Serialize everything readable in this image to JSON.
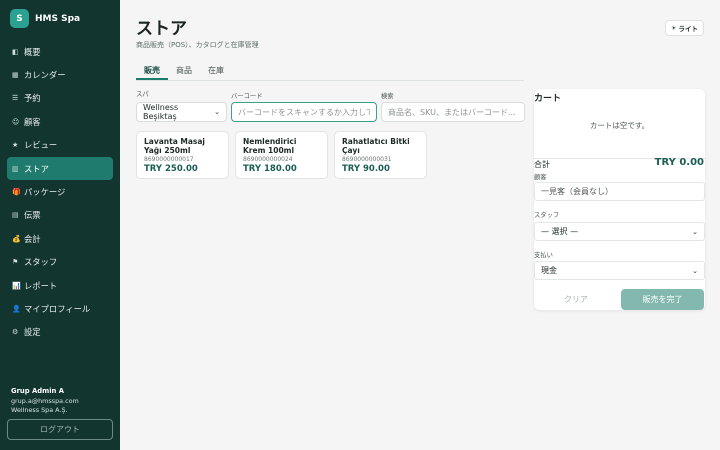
{
  "app": {
    "logo_letter": "S",
    "name": "HMS Spa"
  },
  "sidebar": {
    "items": [
      {
        "icon": "◧",
        "label": "概要"
      },
      {
        "icon": "▦",
        "label": "カレンダー"
      },
      {
        "icon": "☰",
        "label": "予約"
      },
      {
        "icon": "☺",
        "label": "顧客"
      },
      {
        "icon": "★",
        "label": "レビュー"
      },
      {
        "icon": "▥",
        "label": "ストア"
      },
      {
        "icon": "🎁",
        "label": "パッケージ"
      },
      {
        "icon": "▤",
        "label": "伝票"
      },
      {
        "icon": "💰",
        "label": "会計"
      },
      {
        "icon": "⚑",
        "label": "スタッフ"
      },
      {
        "icon": "📊",
        "label": "レポート"
      },
      {
        "icon": "👤",
        "label": "マイプロフィール"
      },
      {
        "icon": "⚙",
        "label": "設定"
      }
    ],
    "active_index": 5
  },
  "user": {
    "name": "Grup Admin A",
    "email": "grup.a@hmsspa.com",
    "company": "Wellness Spa A.Ş."
  },
  "logout_label": "ログアウト",
  "page": {
    "title": "ストア",
    "subtitle": "商品販売（POS）、カタログと在庫管理"
  },
  "theme_toggle": {
    "icon": "☀",
    "label": "ライト"
  },
  "tabs": [
    {
      "label": "販売"
    },
    {
      "label": "商品"
    },
    {
      "label": "在庫"
    }
  ],
  "filters": {
    "spa_label": "スパ",
    "spa_value": "Wellness Beşiktaş",
    "barcode_label": "バーコード",
    "barcode_placeholder": "バーコードをスキャンするか入力して",
    "search_label": "検索",
    "search_placeholder": "商品名、SKU、またはバーコード..."
  },
  "products": [
    {
      "name": "Lavanta Masaj Yağı 250ml",
      "sku": "8690000000017",
      "price": "TRY 250.00"
    },
    {
      "name": "Nemlendirici Krem 100ml",
      "sku": "8690000000024",
      "price": "TRY 180.00"
    },
    {
      "name": "Rahatlatıcı Bitki Çayı",
      "sku": "8690000000031",
      "price": "TRY 90.00"
    }
  ],
  "cart": {
    "title": "カート",
    "empty_text": "カートは空です。",
    "total_label": "合計",
    "total_value": "TRY 0.00",
    "customer_label": "顧客",
    "customer_placeholder": "一見客（会員なし）",
    "staff_label": "スタッフ",
    "staff_value": "— 選択 —",
    "payment_label": "支払い",
    "payment_value": "現金",
    "clear_label": "クリア",
    "complete_label": "販売を完了"
  },
  "colors": {
    "sidebar_bg": "#123530",
    "accent": "#1f7b6e",
    "price": "#1b5e52",
    "complete_button": "#82b8ad"
  }
}
